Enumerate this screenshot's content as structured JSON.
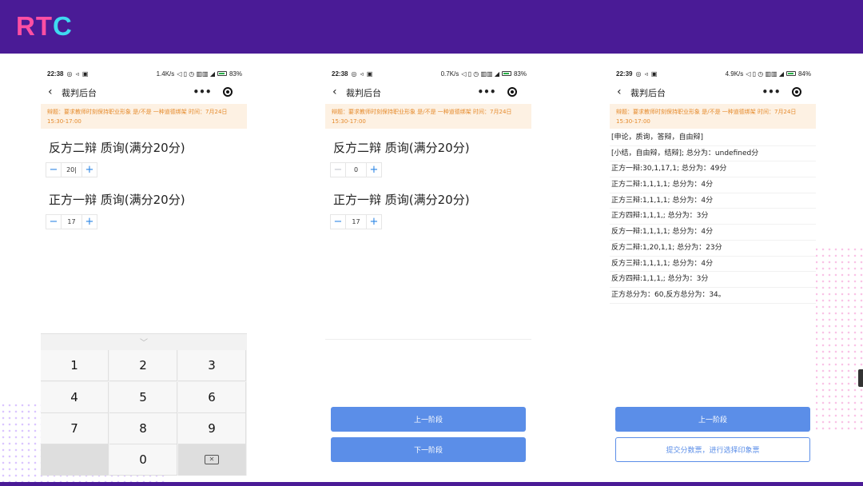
{
  "brand": {
    "logo": "RTC"
  },
  "phone1": {
    "status": {
      "time": "22:38",
      "speed": "1.4K/s",
      "battery": "83%"
    },
    "nav": {
      "back": "‹",
      "title": "裁判后台",
      "more": "•••"
    },
    "notice": "辩题：要求教师时刻保持职业形象 是/不是 一种道德绑架 时间：7月24日 15:30-17:00",
    "q1": {
      "title": "反方二辩 质询(满分20分)",
      "value": "20|",
      "minus": "−",
      "plus": "+"
    },
    "q2": {
      "title": "正方一辩 质询(满分20分)",
      "value": "17",
      "minus": "−",
      "plus": "+"
    },
    "keyboard": {
      "chevron": "﹀",
      "keys": [
        "1",
        "2",
        "3",
        "4",
        "5",
        "6",
        "7",
        "8",
        "9",
        "0"
      ],
      "delete": "✕"
    }
  },
  "phone2": {
    "status": {
      "time": "22:38",
      "speed": "0.7K/s",
      "battery": "83%"
    },
    "nav": {
      "back": "‹",
      "title": "裁判后台",
      "more": "•••"
    },
    "notice": "辩题：要求教师时刻保持职业形象 是/不是 一种道德绑架 时间：7月24日 15:30-17:00",
    "q1": {
      "title": "反方二辩 质询(满分20分)",
      "value": "0",
      "minus": "−",
      "plus": "+"
    },
    "q2": {
      "title": "正方一辩 质询(满分20分)",
      "value": "17",
      "minus": "−",
      "plus": "+"
    },
    "buttons": {
      "prev": "上一阶段",
      "next": "下一阶段"
    }
  },
  "phone3": {
    "status": {
      "time": "22:39",
      "speed": "4.9K/s",
      "battery": "84%"
    },
    "nav": {
      "back": "‹",
      "title": "裁判后台",
      "more": "•••"
    },
    "notice": "辩题：要求教师时刻保持职业形象 是/不是 一种道德绑架 时间：7月24日 15:30-17:00",
    "lines": [
      "[申论，质询，答辩，自由辩]",
      "[小结，自由辩，结辩]; 总分为：undefined分",
      "正方一辩:30,1,17,1; 总分为：49分",
      "正方二辩:1,1,1,1; 总分为：4分",
      "正方三辩:1,1,1,1; 总分为：4分",
      "正方四辩:1,1,1,; 总分为：3分",
      "反方一辩:1,1,1,1; 总分为：4分",
      "反方二辩:1,20,1,1; 总分为：23分",
      "反方三辩:1,1,1,1; 总分为：4分",
      "反方四辩:1,1,1,; 总分为：3分",
      "正方总分为：60,反方总分为：34。"
    ],
    "buttons": {
      "prev": "上一阶段",
      "submit": "提交分数票，进行选择印象票"
    }
  },
  "colors": {
    "brand_bar": "#4a1b96",
    "primary": "#5b8ee8",
    "notice_bg": "#fdf1e3",
    "notice_text": "#e58a2b"
  }
}
